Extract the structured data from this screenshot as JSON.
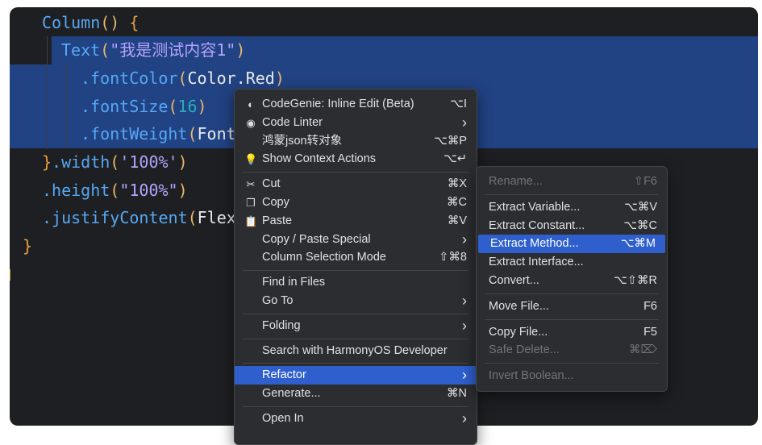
{
  "code_lines": [
    [
      {
        "t": "Column",
        "c": "c-fn2"
      },
      {
        "t": "()",
        "c": "c-paren"
      },
      {
        "t": " ",
        "c": "c-plain"
      },
      {
        "t": "{",
        "c": "c-brace"
      }
    ],
    [
      {
        "t": "Text",
        "c": "c-fn2"
      },
      {
        "t": "(",
        "c": "c-paren"
      },
      {
        "t": "\"我是测试内容1\"",
        "c": "c-str2"
      },
      {
        "t": ")",
        "c": "c-paren"
      }
    ],
    [
      {
        "t": ".fontColor",
        "c": "c-fn"
      },
      {
        "t": "(",
        "c": "c-paren"
      },
      {
        "t": "Color.Red",
        "c": "c-plain"
      },
      {
        "t": ")",
        "c": "c-paren"
      }
    ],
    [
      {
        "t": ".fontSize",
        "c": "c-fn"
      },
      {
        "t": "(",
        "c": "c-paren"
      },
      {
        "t": "16",
        "c": "c-num"
      },
      {
        "t": ")",
        "c": "c-paren"
      }
    ],
    [
      {
        "t": ".fontWeight",
        "c": "c-fn"
      },
      {
        "t": "(",
        "c": "c-paren"
      },
      {
        "t": "Font",
        "c": "c-plain"
      }
    ],
    [
      {
        "t": "}",
        "c": "c-brace"
      },
      {
        "t": ".width",
        "c": "c-fn"
      },
      {
        "t": "(",
        "c": "c-paren"
      },
      {
        "t": "'100%'",
        "c": "c-str2"
      },
      {
        "t": ")",
        "c": "c-paren"
      }
    ],
    [
      {
        "t": ".height",
        "c": "c-fn"
      },
      {
        "t": "(",
        "c": "c-paren"
      },
      {
        "t": "\"100%\"",
        "c": "c-str2"
      },
      {
        "t": ")",
        "c": "c-paren"
      }
    ],
    [
      {
        "t": ".justifyContent",
        "c": "c-fn"
      },
      {
        "t": "(",
        "c": "c-paren"
      },
      {
        "t": "Flex",
        "c": "c-plain"
      }
    ],
    [
      {
        "t": "}",
        "c": "c-brace"
      }
    ]
  ],
  "context_menu": {
    "items": [
      {
        "label": "CodeGenie: Inline Edit (Beta)",
        "shortcut": "⌥I",
        "icon": "codegenie-icon",
        "glyph": "◐"
      },
      {
        "label": "Code Linter",
        "submenu": true,
        "icon": "code-linter-icon",
        "glyph": "◉"
      },
      {
        "label": "鸿蒙json转对象",
        "shortcut": "⌥⌘P"
      },
      {
        "label": "Show Context Actions",
        "shortcut": "⌥↵",
        "icon": "lightbulb-icon",
        "glyph": "💡"
      },
      {
        "sep": true
      },
      {
        "label": "Cut",
        "shortcut": "⌘X",
        "icon": "scissors-icon",
        "glyph": "✂"
      },
      {
        "label": "Copy",
        "shortcut": "⌘C",
        "icon": "copy-icon",
        "glyph": "❐"
      },
      {
        "label": "Paste",
        "shortcut": "⌘V",
        "icon": "clipboard-icon",
        "glyph": "📋"
      },
      {
        "label": "Copy / Paste Special",
        "submenu": true
      },
      {
        "label": "Column Selection Mode",
        "shortcut": "⇧⌘8"
      },
      {
        "sep": true
      },
      {
        "label": "Find in Files"
      },
      {
        "label": "Go To",
        "submenu": true
      },
      {
        "sep": true
      },
      {
        "label": "Folding",
        "submenu": true
      },
      {
        "sep": true
      },
      {
        "label": "Search with HarmonyOS Developer"
      },
      {
        "sep": true
      },
      {
        "label": "Refactor",
        "submenu": true,
        "active": true
      },
      {
        "label": "Generate...",
        "shortcut": "⌘N"
      },
      {
        "sep": true
      },
      {
        "label": "Open In",
        "submenu": true
      }
    ]
  },
  "refactor_submenu": {
    "items": [
      {
        "label": "Rename...",
        "shortcut": "⇧F6",
        "disabled": true
      },
      {
        "sep": true
      },
      {
        "label": "Extract Variable...",
        "shortcut": "⌥⌘V"
      },
      {
        "label": "Extract Constant...",
        "shortcut": "⌥⌘C"
      },
      {
        "label": "Extract Method...",
        "shortcut": "⌥⌘M",
        "active": true
      },
      {
        "label": "Extract Interface..."
      },
      {
        "label": "Convert...",
        "shortcut": "⌥⇧⌘R"
      },
      {
        "sep": true
      },
      {
        "label": "Move File...",
        "shortcut": "F6"
      },
      {
        "sep": true
      },
      {
        "label": "Copy File...",
        "shortcut": "F5"
      },
      {
        "label": "Safe Delete...",
        "shortcut": "⌘⌦",
        "disabled": true
      },
      {
        "sep": true
      },
      {
        "label": "Invert Boolean...",
        "disabled": true
      }
    ]
  },
  "colors": {
    "editor_bg": "#1e1f22",
    "selection": "#214283",
    "menu_bg": "#2b2d30",
    "menu_highlight": "#2e5fcc"
  }
}
